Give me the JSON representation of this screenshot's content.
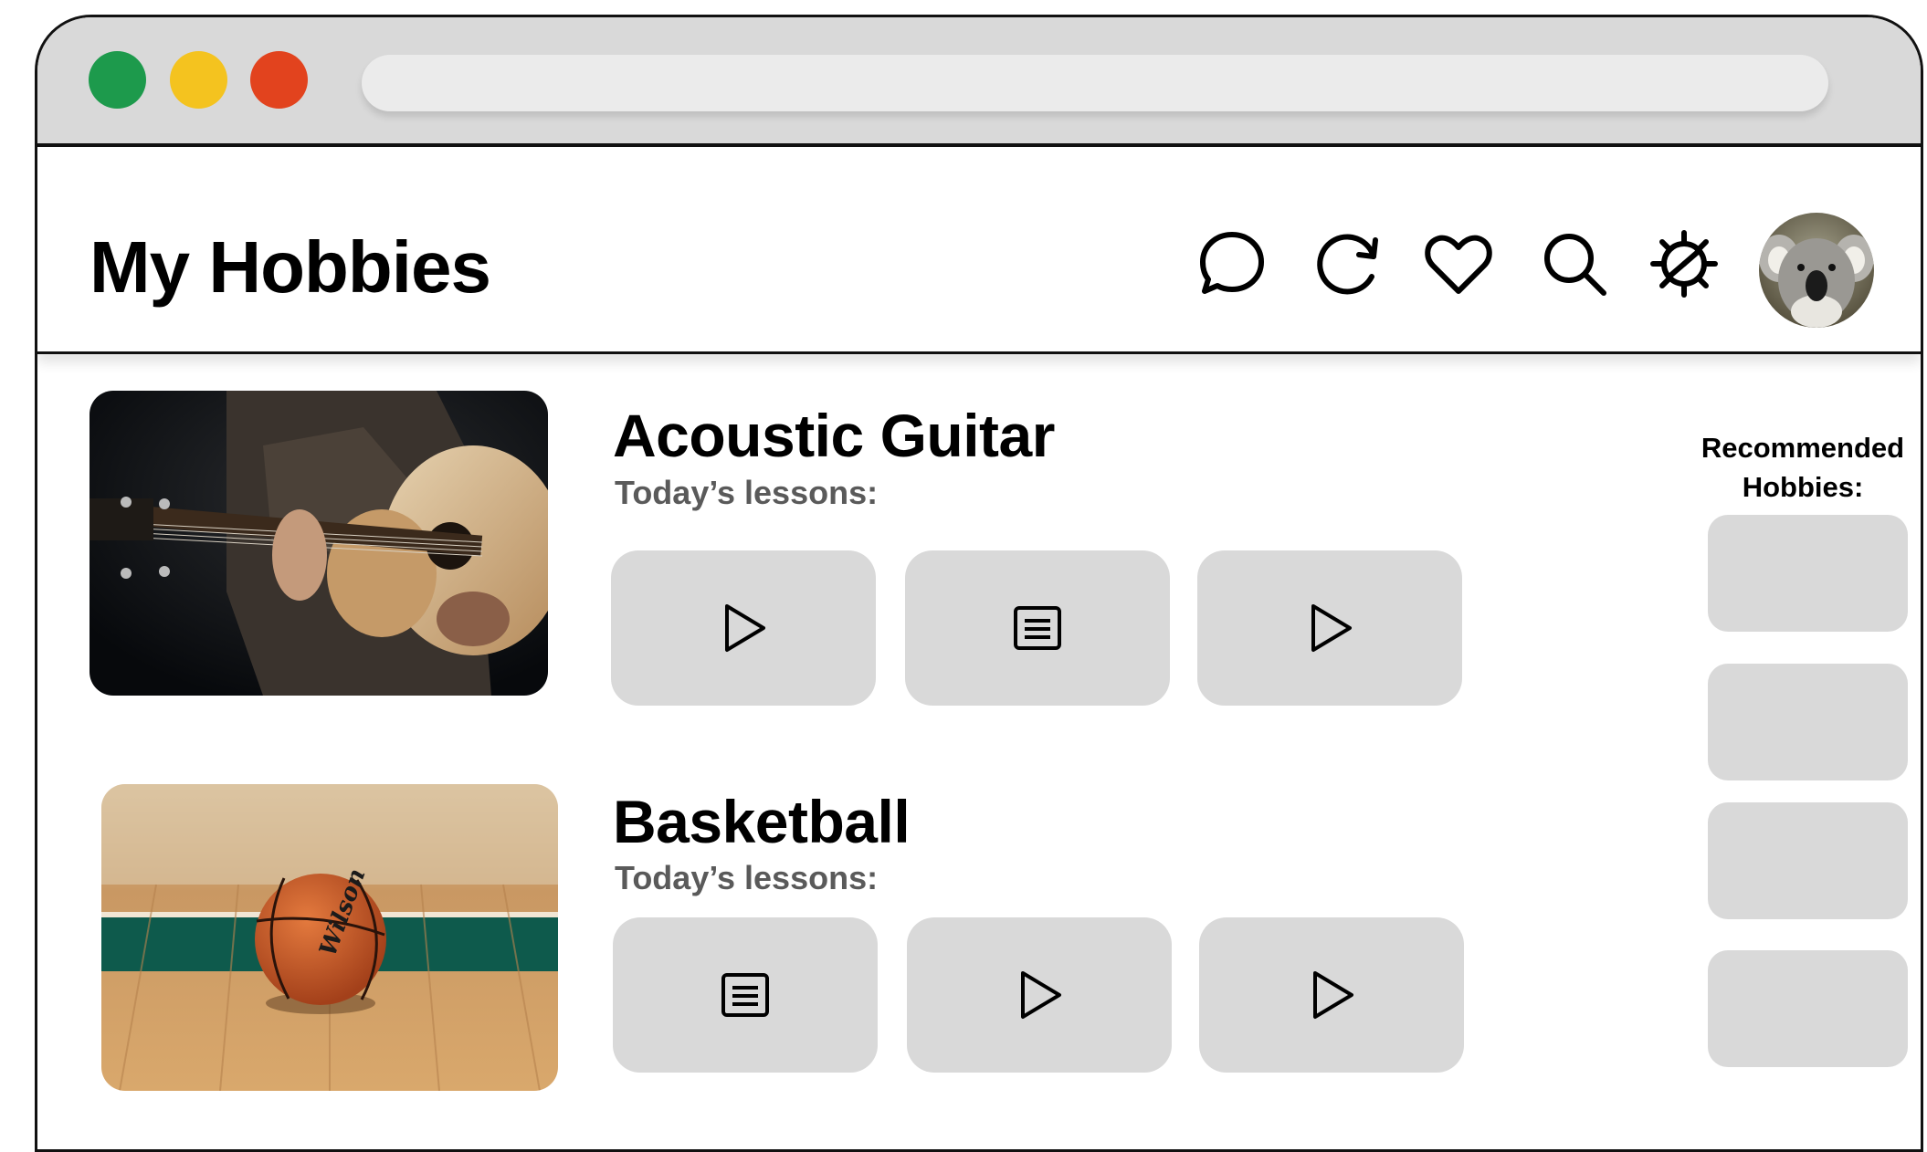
{
  "window": {
    "traffic_lights": [
      {
        "name": "green",
        "color": "#1d9a4c"
      },
      {
        "name": "yellow",
        "color": "#f4c31f"
      },
      {
        "name": "red",
        "color": "#e2431e"
      }
    ],
    "url_bar": {
      "value": ""
    }
  },
  "header": {
    "title": "My Hobbies",
    "icons": [
      "chat-bubble-icon",
      "refresh-icon",
      "heart-icon",
      "search-icon",
      "settings-gear-icon"
    ],
    "avatar": "koala-avatar"
  },
  "hobbies": [
    {
      "title": "Acoustic Guitar",
      "subtitle": "Today’s lessons:",
      "image": "man playing acoustic guitar",
      "lessons": [
        "play-icon",
        "document-icon",
        "play-icon"
      ]
    },
    {
      "title": "Basketball",
      "subtitle": "Today’s lessons:",
      "image": "Wilson basketball on hardwood court",
      "lessons": [
        "document-icon",
        "play-icon",
        "play-icon"
      ]
    }
  ],
  "recommended": {
    "title_line1": "Recommended",
    "title_line2": "Hobbies:",
    "cards_count": 4
  },
  "colors": {
    "card_gray": "#d9d9d9",
    "titlebar_gray": "#d9d9d9",
    "subtitle_gray": "#5a5a5a"
  }
}
